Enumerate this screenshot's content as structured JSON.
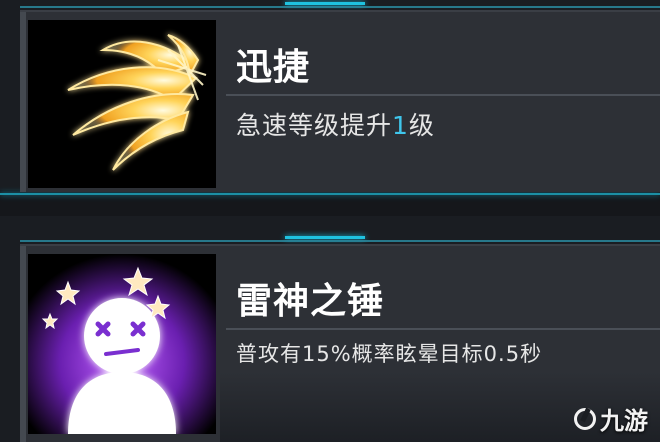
{
  "skills": [
    {
      "name": "迅捷",
      "desc_before": "急速等级提升",
      "desc_highlight": "1",
      "desc_after": "级",
      "icon": "flame-wing-icon",
      "highlight_color": "#3fc6ec"
    },
    {
      "name": "雷神之锤",
      "desc_before": "普攻有15%概率眩晕目标0.5秒",
      "icon": "dizzy-stars-icon"
    }
  ],
  "watermark": {
    "text": "九游",
    "icon": "jiuyou-logo-icon"
  }
}
